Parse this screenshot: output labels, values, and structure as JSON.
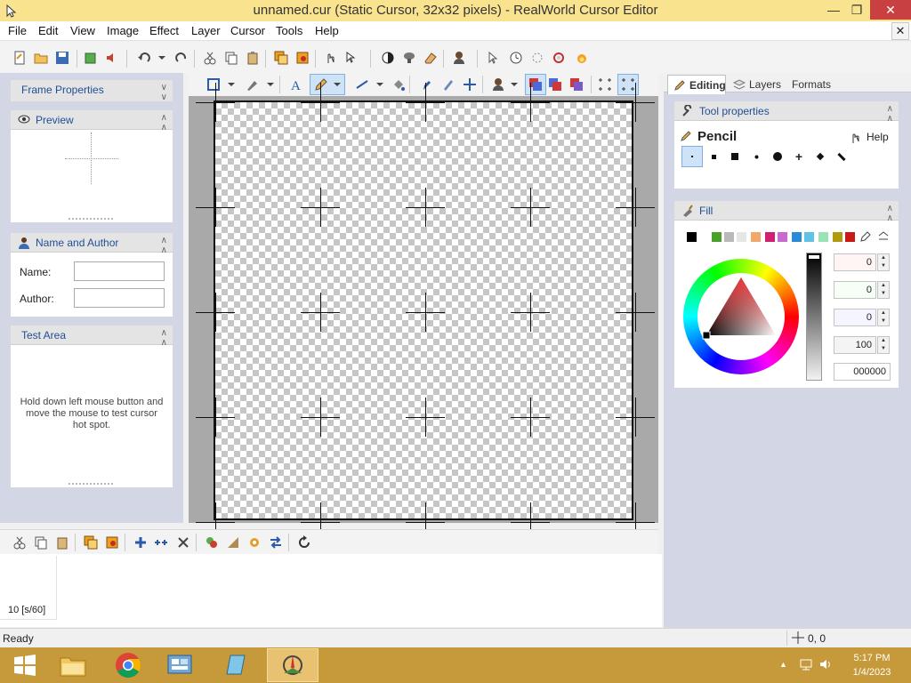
{
  "window": {
    "title": "unnamed.cur (Static Cursor, 32x32 pixels) - RealWorld Cursor Editor",
    "minimize": "—",
    "maximize": "❐",
    "close": "✕"
  },
  "menu": [
    "File",
    "Edit",
    "View",
    "Image",
    "Effect",
    "Layer",
    "Cursor",
    "Tools",
    "Help"
  ],
  "mdi_close": "✕",
  "left_panel": {
    "frame_properties": "Frame Properties",
    "preview": "Preview",
    "name_and_author": "Name and Author",
    "name_label": "Name:",
    "name_value": "",
    "author_label": "Author:",
    "author_value": "",
    "test_area": "Test Area",
    "test_area_hint": "Hold down left mouse button and move the mouse to test cursor hot spot."
  },
  "right_panel": {
    "tabs": [
      "Editing",
      "Layers",
      "Formats"
    ],
    "tool_properties": "Tool properties",
    "tool_name": "Pencil",
    "help": "Help",
    "fill": "Fill",
    "values": [
      "0",
      "0",
      "0",
      "100",
      "000000"
    ]
  },
  "frame_strip": {
    "frame_label": "10 [s/60]"
  },
  "status": {
    "text": "Ready",
    "coords": "0, 0"
  },
  "taskbar": {
    "time": "5:17 PM",
    "date": "1/4/2023"
  },
  "colors": {
    "title_bar": "#f9e38f",
    "taskbar": "#c69a3a",
    "panel_bg": "#d3d6e4",
    "header_text": "#1f4e96"
  },
  "swatches": [
    "#000000",
    "#4aa12a",
    "#b9b9b9",
    "#e6e6e6",
    "#f3a86b",
    "#d02070",
    "#c86ad0",
    "#2a8ad8",
    "#5fc3e8",
    "#98e4b4",
    "#b29a10",
    "#c81818"
  ]
}
